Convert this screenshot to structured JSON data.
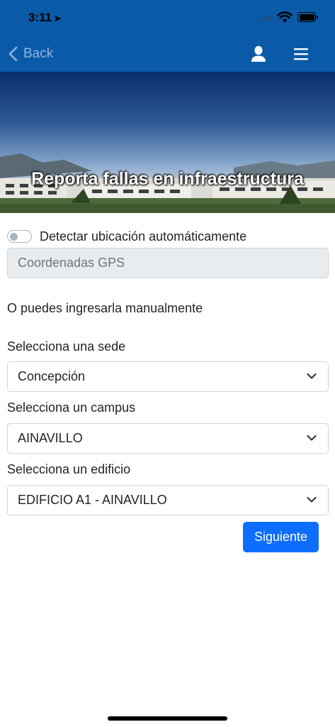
{
  "status_bar": {
    "time": "3:11"
  },
  "navbar": {
    "back_label": "Back"
  },
  "hero": {
    "title": "Reporta fallas en infraestructura"
  },
  "form": {
    "auto_location_label": "Detectar ubicación automáticamente",
    "auto_location_enabled": false,
    "gps_placeholder": "Coordenadas GPS",
    "manual_text": "O puedes ingresarla manualmente",
    "sede_label": "Selecciona una sede",
    "sede_value": "Concepción",
    "campus_label": "Selecciona un campus",
    "campus_value": "AINAVILLO",
    "edificio_label": "Selecciona un edificio",
    "edificio_value": "EDIFICIO A1 - AINAVILLO",
    "next_label": "Siguiente"
  },
  "colors": {
    "navbar": "#0a5aa8",
    "primary_button": "#0d6efd",
    "input_disabled_bg": "#e9ecef"
  },
  "icons": [
    "location-arrow-icon",
    "signal-icon",
    "wifi-icon",
    "battery-icon",
    "chevron-left-icon",
    "user-icon",
    "menu-icon",
    "chevron-down-icon"
  ]
}
